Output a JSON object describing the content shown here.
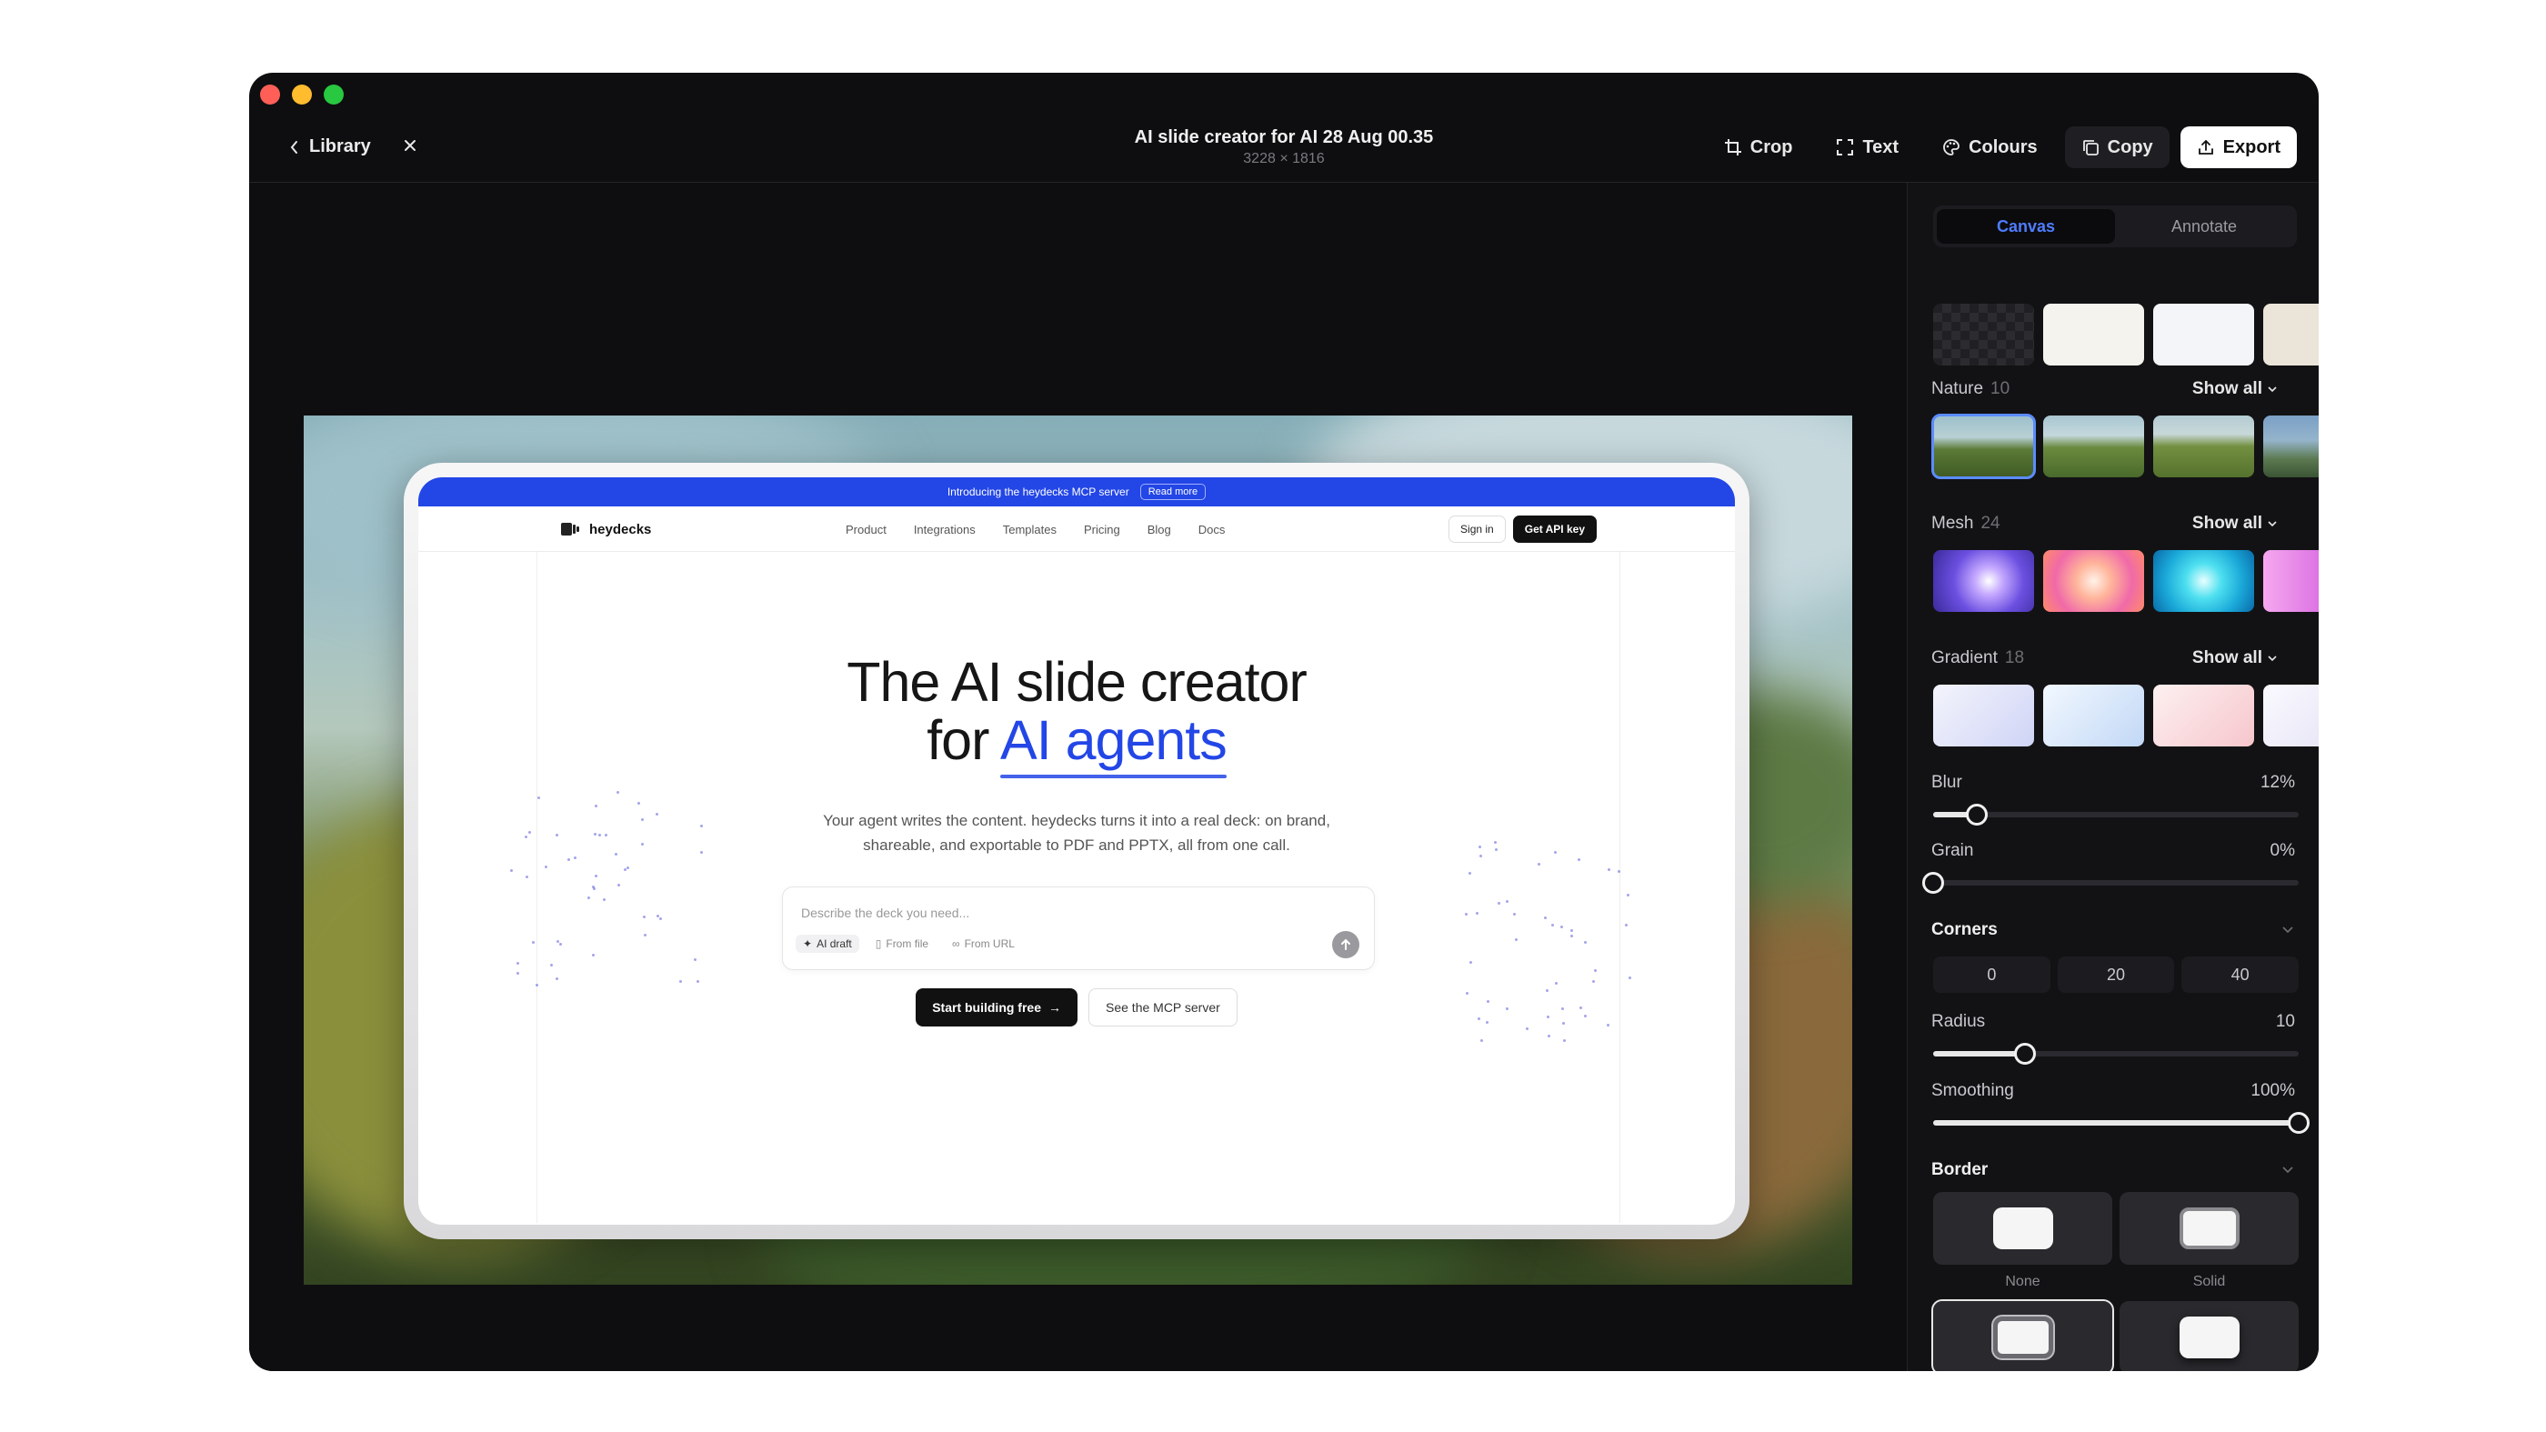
{
  "window": {
    "traffic_lights": [
      "#ff5f57",
      "#febc2e",
      "#28c840"
    ],
    "back_label": "Library",
    "title": "AI slide creator for AI 28 Aug 00.35",
    "subtitle": "3228 × 1816"
  },
  "toolbar": {
    "crop": "Crop",
    "text": "Text",
    "colours": "Colours",
    "copy": "Copy",
    "export": "Export"
  },
  "preview": {
    "banner_text": "Introducing the heydecks MCP server",
    "banner_link": "Read more",
    "brand": "heydecks",
    "nav_links": [
      "Product",
      "Integrations",
      "Templates",
      "Pricing",
      "Blog",
      "Docs"
    ],
    "sign_in": "Sign in",
    "get_api_key": "Get API key",
    "headline_line1": "The AI slide creator",
    "headline_for": "for",
    "headline_accent": "AI agents",
    "subtext_line1": "Your agent writes the content. heydecks turns it into a real deck: on brand,",
    "subtext_line2": "shareable, and exportable to PDF and PPTX, all from one call.",
    "prompt_placeholder": "Describe the deck you need...",
    "chip_ai": "AI draft",
    "chip_file": "From file",
    "chip_url": "From URL",
    "cta_primary": "Start building free",
    "cta_secondary": "See the MCP server",
    "accent_color": "#2346e6"
  },
  "panel": {
    "tabs": [
      "Canvas",
      "Annotate"
    ],
    "active_tab": "Canvas",
    "sections": [
      {
        "name": "Nature",
        "count": "10",
        "show_all": "Show all"
      },
      {
        "name": "Mesh",
        "count": "24",
        "show_all": "Show all"
      },
      {
        "name": "Gradient",
        "count": "18",
        "show_all": "Show all"
      }
    ],
    "blur": {
      "label": "Blur",
      "value": "12%",
      "level": 0.12
    },
    "grain": {
      "label": "Grain",
      "value": "0%",
      "level": 0
    },
    "corners": {
      "label": "Corners",
      "options": [
        "0",
        "20",
        "40"
      ]
    },
    "radius": {
      "label": "Radius",
      "value": "10",
      "level": 0.25
    },
    "smoothing": {
      "label": "Smoothing",
      "value": "100%",
      "level": 1
    },
    "border": {
      "label": "Border",
      "options": [
        "None",
        "Solid"
      ]
    }
  }
}
